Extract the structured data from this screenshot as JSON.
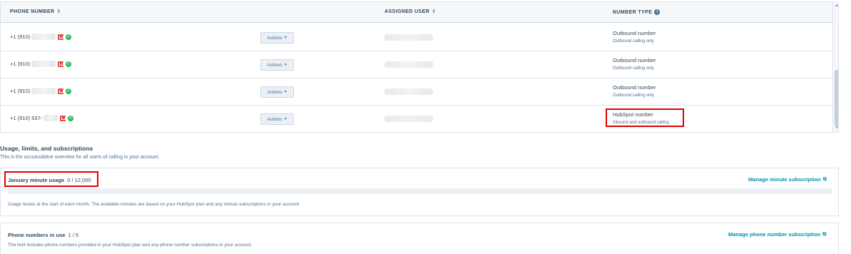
{
  "table": {
    "headers": {
      "phone_number": "PHONE NUMBER",
      "assigned_user": "ASSIGNED USER",
      "number_type": "NUMBER TYPE"
    },
    "rows": [
      {
        "phone": "+1 (910)",
        "actions": "Actions",
        "type": "Outbound number",
        "type_sub": "Outbound calling only"
      },
      {
        "phone": "+1 (910)",
        "actions": "Actions",
        "type": "Outbound number",
        "type_sub": "Outbound calling only"
      },
      {
        "phone": "+1 (910)",
        "actions": "Actions",
        "type": "Outbound number",
        "type_sub": "Outbound calling only"
      },
      {
        "phone": "+1 (910) 537-",
        "actions": "Actions",
        "type": "HubSpot number",
        "type_sub": "Inbound and outbound calling"
      }
    ]
  },
  "usage": {
    "title": "Usage, limits, and subscriptions",
    "description": "This is the accumulative overview for all users of calling in your account.",
    "minutes": {
      "label": "January minute usage",
      "value": "0 / 12,000",
      "used_fraction": 0,
      "link": "Manage minute subscription",
      "note": "Usage resets at the start of each month. The available minutes are based on your HubSpot plan and any minute subscriptions in your account."
    },
    "phone_numbers": {
      "label": "Phone numbers in use",
      "value": "1 / 5",
      "link": "Manage phone number subscription",
      "note": "The limit includes phone numbers provided in your HubSpot plan and any phone number subscriptions in your account."
    }
  },
  "colors": {
    "accent_link": "#0091ae",
    "highlight": "#e00000"
  }
}
